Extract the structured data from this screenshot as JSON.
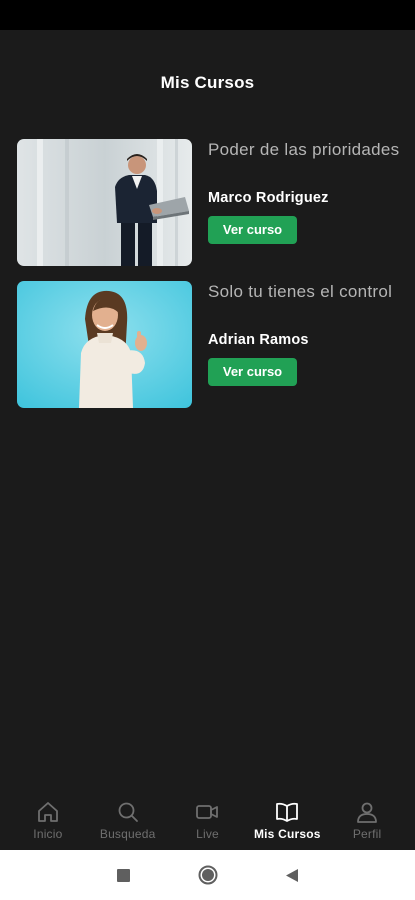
{
  "header": {
    "title": "Mis Cursos"
  },
  "courses": [
    {
      "title": "Poder de las prioridades",
      "author": "Marco Rodriguez",
      "button_label": "Ver curso"
    },
    {
      "title": "Solo tu tienes el control",
      "author": "Adrian Ramos",
      "button_label": "Ver curso"
    }
  ],
  "bottom_nav": {
    "items": [
      {
        "label": "Inicio",
        "icon": "home-icon",
        "active": false
      },
      {
        "label": "Busqueda",
        "icon": "search-icon",
        "active": false
      },
      {
        "label": "Live",
        "icon": "video-camera-icon",
        "active": false
      },
      {
        "label": "Mis Cursos",
        "icon": "open-book-icon",
        "active": true
      },
      {
        "label": "Perfil",
        "icon": "person-icon",
        "active": false
      }
    ]
  },
  "system_nav": {
    "icons": [
      "square-icon",
      "circle-icon",
      "back-triangle-icon"
    ]
  },
  "colors": {
    "background": "#1b1b1b",
    "accent": "#21a155",
    "inactive": "#6f6f6f"
  }
}
